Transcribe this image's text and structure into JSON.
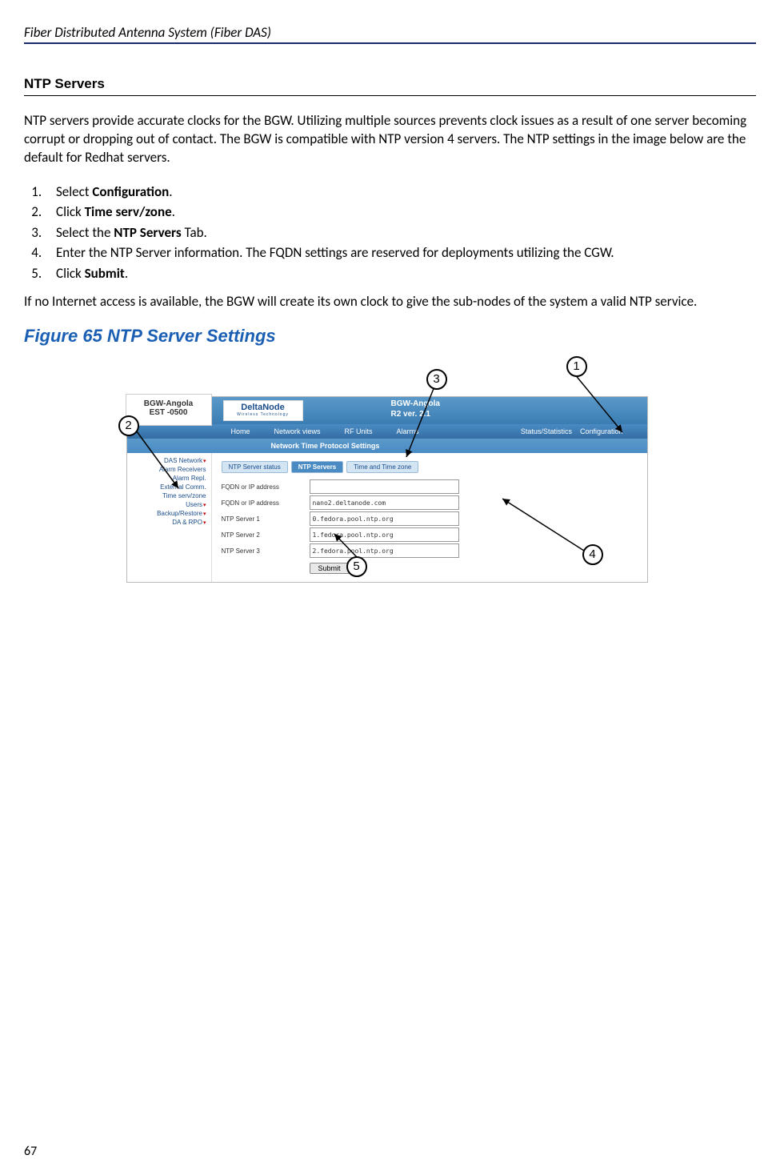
{
  "header": "Fiber Distributed Antenna System (Fiber DAS)",
  "section_title": "NTP Servers",
  "intro": "NTP servers provide accurate clocks for the BGW. Utilizing multiple sources prevents clock issues as a result of one server becoming corrupt or dropping out of contact. The BGW is compatible with NTP version 4 servers. The NTP settings in the image below are the default for Redhat servers.",
  "steps": {
    "s1_pre": "Select ",
    "s1_bold": "Configuration",
    "s1_post": ".",
    "s2_pre": "Click ",
    "s2_bold": "Time serv/zone",
    "s2_post": ".",
    "s3_pre": "Select the ",
    "s3_bold": "NTP Servers",
    "s3_post": " Tab.",
    "s4": "Enter the NTP Server information. The FQDN settings are reserved for deployments utilizing the CGW.",
    "s5_pre": "Click ",
    "s5_bold": "Submit",
    "s5_post": "."
  },
  "outro": "If no Internet access is available, the BGW will create its own clock to give the sub-nodes of the system a valid NTP service.",
  "figure_caption": "Figure 65    NTP Server Settings",
  "screenshot": {
    "top_left_line1": "BGW-Angola",
    "top_left_line2": "EST -0500",
    "logo": "DeltaNode",
    "logo_sub": "Wireless  Technology",
    "title_line1": "BGW-Angola",
    "title_line2": "R2 ver. 2.1",
    "nav": {
      "home": "Home",
      "networkviews": "Network views",
      "rfunits": "RF Units",
      "alarms": "Alarms",
      "status": "Status/Statistics",
      "config": "Configuration"
    },
    "subbar": "Network Time Protocol Settings",
    "side": {
      "das": "DAS Network",
      "alarm_recv": "Alarm Receivers",
      "alarm_repl": "Alarm Repl.",
      "ext": "External Comm.",
      "time": "Time serv/zone",
      "users": "Users",
      "backup": "Backup/Restore",
      "darpo": "DA & RPO"
    },
    "tabs": {
      "status": "NTP Server status",
      "servers": "NTP Servers",
      "timezone": "Time and Time zone"
    },
    "rows": {
      "fqdn1_label": "FQDN or IP address",
      "fqdn1_val": "",
      "fqdn2_label": "FQDN or IP address",
      "fqdn2_val": "nano2.deltanode.com",
      "ntp1_label": "NTP Server 1",
      "ntp1_val": "0.fedora.pool.ntp.org",
      "ntp2_label": "NTP Server 2",
      "ntp2_val": "1.fedora.pool.ntp.org",
      "ntp3_label": "NTP Server 3",
      "ntp3_val": "2.fedora.pool.ntp.org"
    },
    "submit": "Submit"
  },
  "callouts": {
    "c1": "1",
    "c2": "2",
    "c3": "3",
    "c4": "4",
    "c5": "5"
  },
  "page_number": "67"
}
